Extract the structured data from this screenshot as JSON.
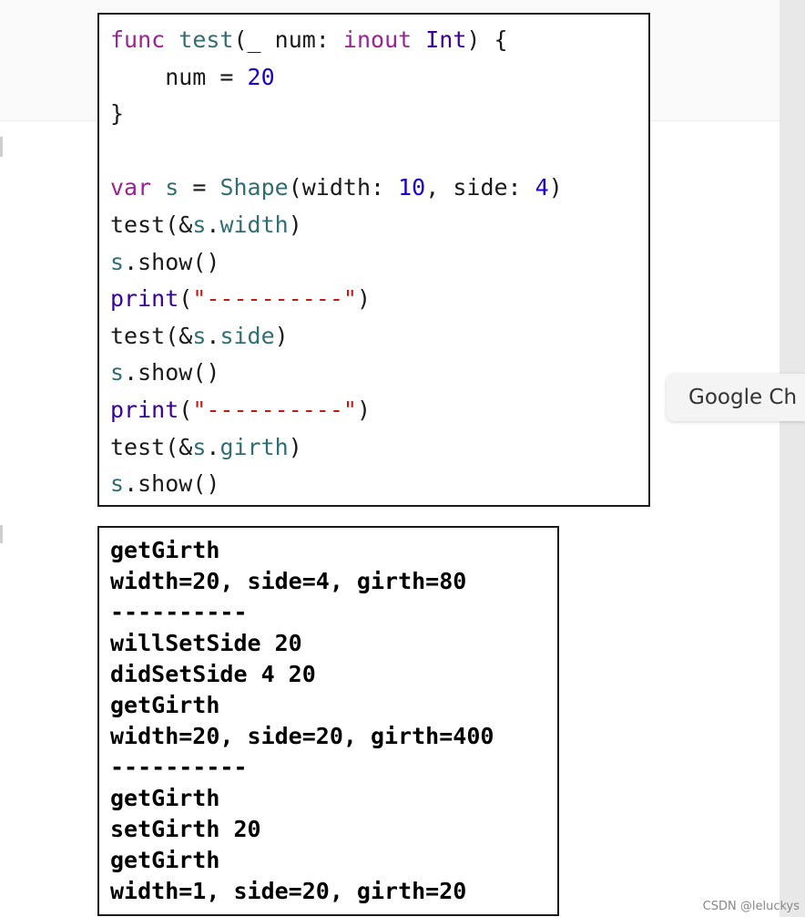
{
  "tooltip": {
    "text": "Google Ch"
  },
  "code": {
    "line1": {
      "kw_func": "func",
      "fn_test": "test",
      "paren_open": "(_ num: ",
      "kw_inout": "inout",
      "space": " ",
      "ty_int": "Int",
      "close": ") {"
    },
    "line2": {
      "indent": "    num = ",
      "num": "20"
    },
    "line3": {
      "text": "}"
    },
    "line5": {
      "kw_var": "var",
      "s_var": "s",
      "eq": " = ",
      "ty_shape": "Shape",
      "args_a": "(width: ",
      "num_a": "10",
      "args_b": ", side: ",
      "num_b": "4",
      "close": ")"
    },
    "line6": {
      "fn": "test",
      "open": "(&",
      "s": "s",
      "dot": ".",
      "prop": "width",
      "close": ")"
    },
    "line7": {
      "s": "s",
      "dot": ".",
      "call": "show",
      "parens": "()"
    },
    "line8": {
      "fn": "print",
      "open": "(",
      "str": "\"----------\"",
      "close": ")"
    },
    "line9": {
      "fn": "test",
      "open": "(&",
      "s": "s",
      "dot": ".",
      "prop": "side",
      "close": ")"
    },
    "line10": {
      "s": "s",
      "dot": ".",
      "call": "show",
      "parens": "()"
    },
    "line11": {
      "fn": "print",
      "open": "(",
      "str": "\"----------\"",
      "close": ")"
    },
    "line12": {
      "fn": "test",
      "open": "(&",
      "s": "s",
      "dot": ".",
      "prop": "girth",
      "close": ")"
    },
    "line13": {
      "s": "s",
      "dot": ".",
      "call": "show",
      "parens": "()"
    }
  },
  "output": {
    "lines": [
      "getGirth",
      "width=20, side=4, girth=80",
      "----------",
      "willSetSide 20",
      "didSetSide 4 20",
      "getGirth",
      "width=20, side=20, girth=400",
      "----------",
      "getGirth",
      "setGirth 20",
      "getGirth",
      "width=1, side=20, girth=20"
    ]
  },
  "watermark": "CSDN @leluckys",
  "colors": {
    "keyword": "#9b2393",
    "function": "#326d74",
    "type": "#3900a0",
    "number": "#1c00cf",
    "string": "#c41a16"
  }
}
